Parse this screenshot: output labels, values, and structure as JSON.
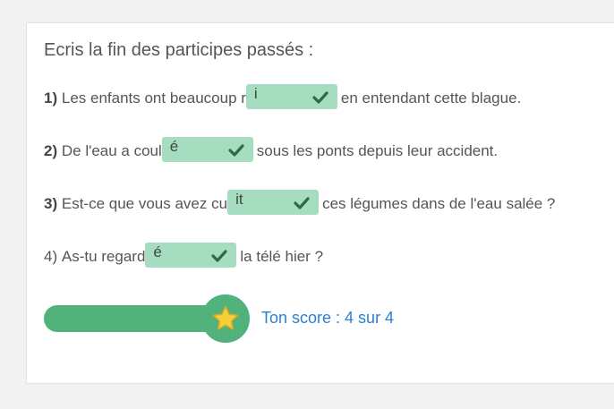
{
  "instruction": "Ecris la fin des participes passés :",
  "questions": [
    {
      "number": "1)",
      "before": "Les enfants ont beaucoup r",
      "answer": "i",
      "after": "en entendant cette blague."
    },
    {
      "number": "2)",
      "before": "De l'eau a coul",
      "answer": "é",
      "after": "sous les ponts depuis leur accident."
    },
    {
      "number": "3)",
      "before": "Est-ce que vous avez cu",
      "answer": "it",
      "after": "ces légumes dans de l'eau salée ?"
    },
    {
      "number": "4)",
      "before": "As-tu regard",
      "answer": "é",
      "after": "la télé hier ?"
    }
  ],
  "score": {
    "label": "Ton score : 4 sur 4",
    "correct": 4,
    "total": 4,
    "progress_fraction": 1.0
  },
  "icons": {
    "answer_status": "check-icon",
    "score_badge": "star-icon"
  },
  "colors": {
    "correct_answer_bg": "#a6ddc0",
    "check": "#2e6a4a",
    "progress": "#52b27b",
    "star": "#f5d03b",
    "score_text": "#2b7fd1"
  }
}
